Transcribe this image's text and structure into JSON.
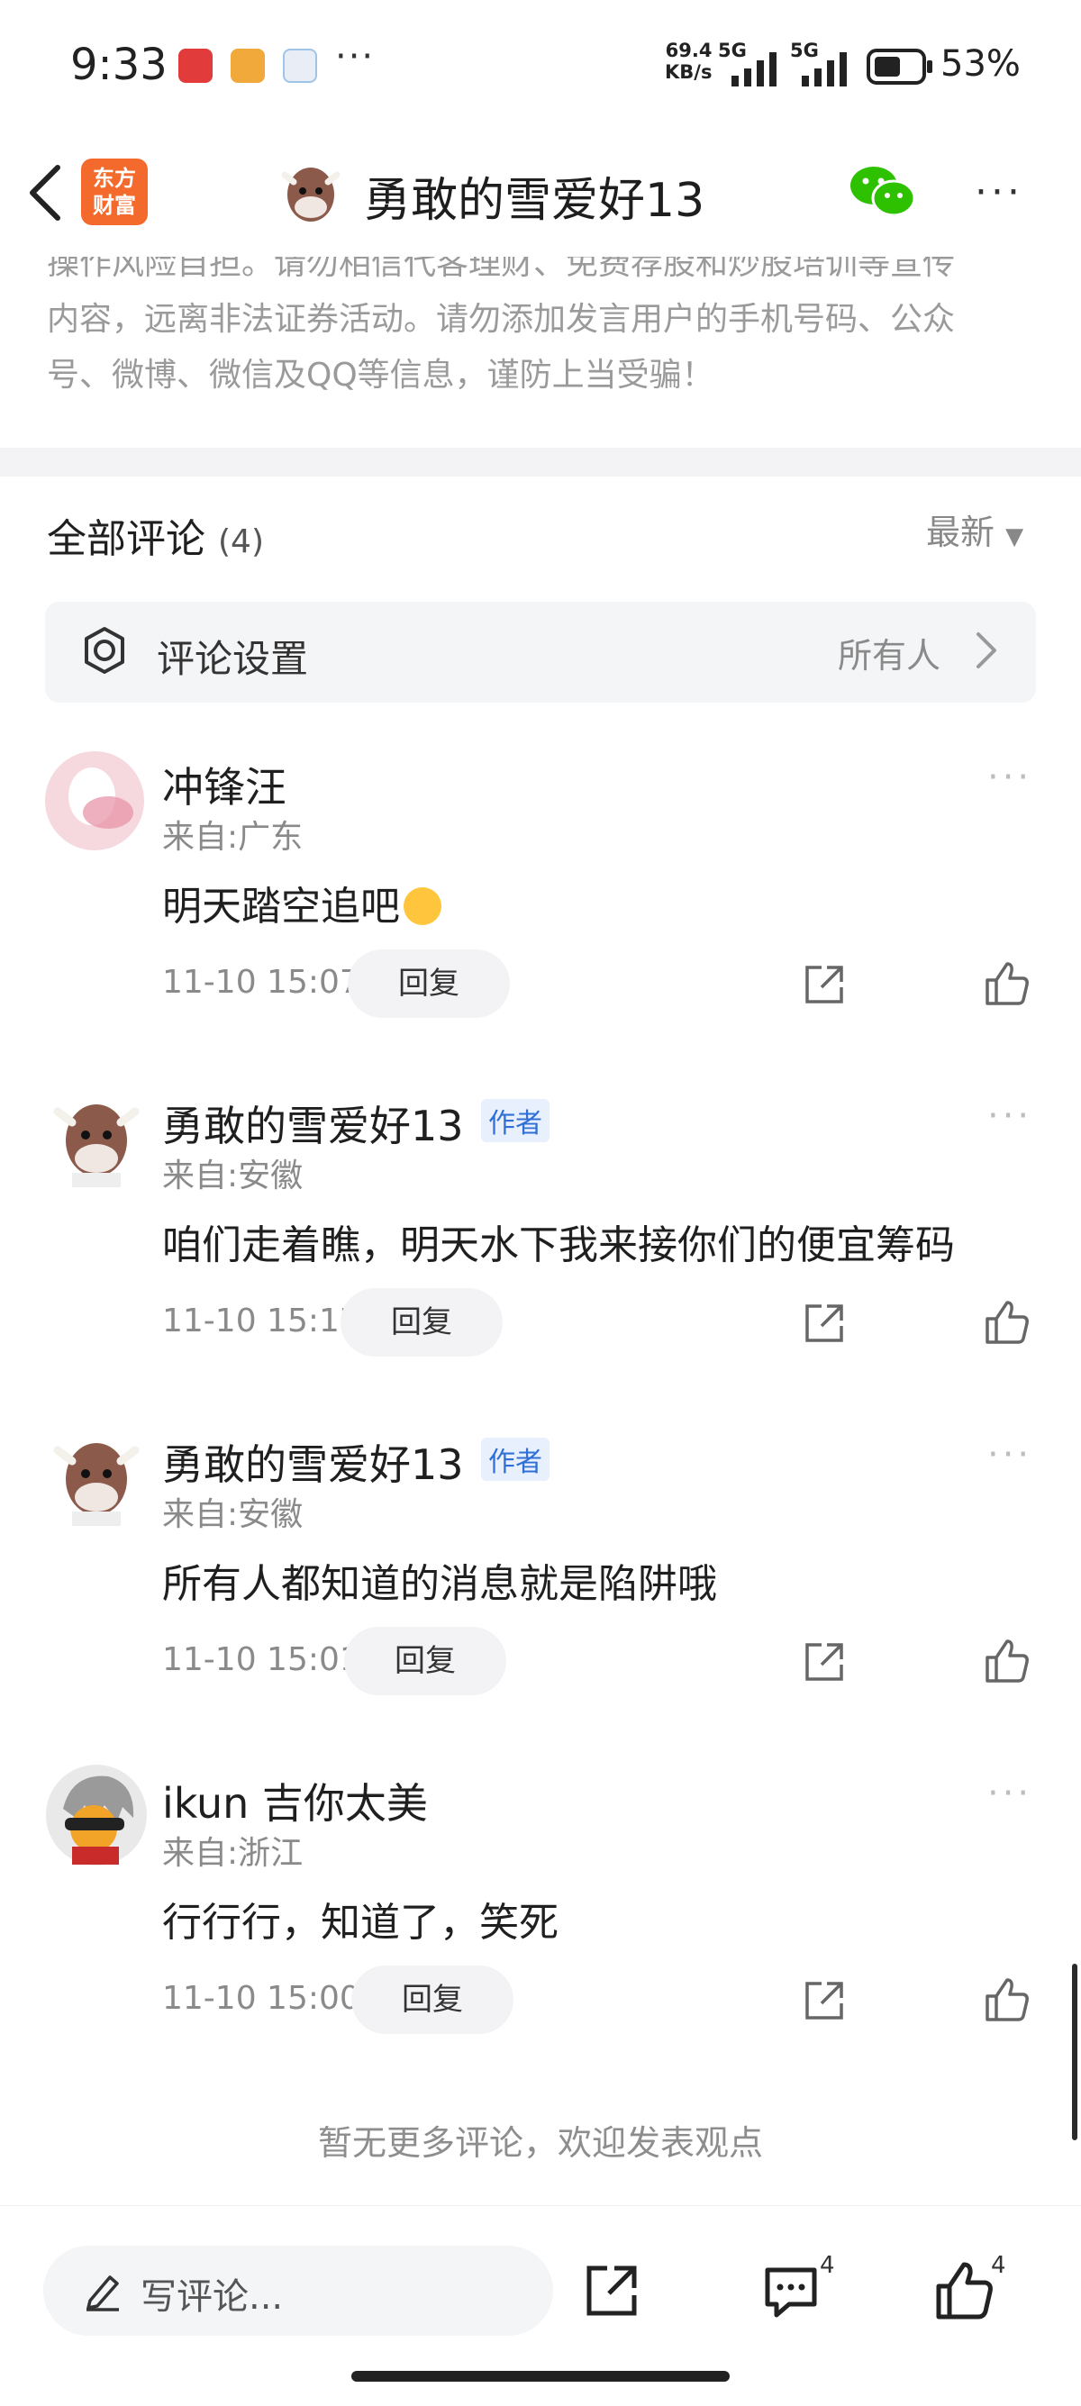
{
  "status_bar": {
    "time": "9:33",
    "dots": "···",
    "net_speed_value": "69.4",
    "net_speed_unit": "KB/s",
    "net1": "5G",
    "net2": "5G",
    "battery": "53%"
  },
  "header": {
    "logo_line1": "东方",
    "logo_line2": "财富",
    "title": "勇敢的雪爱好13"
  },
  "notice": {
    "line1": "操作风险自担。请勿相信代客理财、免费荐股和炒股培训等宣传",
    "line2": "内容，远离非法证券活动。请勿添加发言用户的手机号码、公众",
    "line3": "号、微博、微信及QQ等信息，谨防上当受骗！"
  },
  "comments_section": {
    "title": "全部评论",
    "count": "(4)",
    "sort_label": "最新",
    "settings_label": "评论设置",
    "settings_value": "所有人"
  },
  "comments": [
    {
      "user": "冲锋汪",
      "author_tag": "",
      "location": "来自:广东",
      "text": "明天踏空追吧",
      "time": "11-10 15:07",
      "reply": "回复"
    },
    {
      "user": "勇敢的雪爱好13",
      "author_tag": "作者",
      "location": "来自:安徽",
      "text": "咱们走着瞧，明天水下我来接你们的便宜筹码",
      "time": "11-10 15:17",
      "reply": "回复"
    },
    {
      "user": "勇敢的雪爱好13",
      "author_tag": "作者",
      "location": "来自:安徽",
      "text": "所有人都知道的消息就是陷阱哦",
      "time": "11-10 15:01",
      "reply": "回复"
    },
    {
      "user": "ikun 吉你太美",
      "author_tag": "",
      "location": "来自:浙江",
      "text": "行行行，知道了，笑死",
      "time": "11-10 15:00",
      "reply": "回复"
    }
  ],
  "no_more": "暂无更多评论，欢迎发表观点",
  "bottom_bar": {
    "comment_placeholder": "写评论...",
    "comment_count": "4",
    "like_count": "4"
  },
  "colors": {
    "brand_orange": "#f46a2c",
    "author_blue": "#2f6fd6",
    "wechat_green": "#2dc100"
  }
}
